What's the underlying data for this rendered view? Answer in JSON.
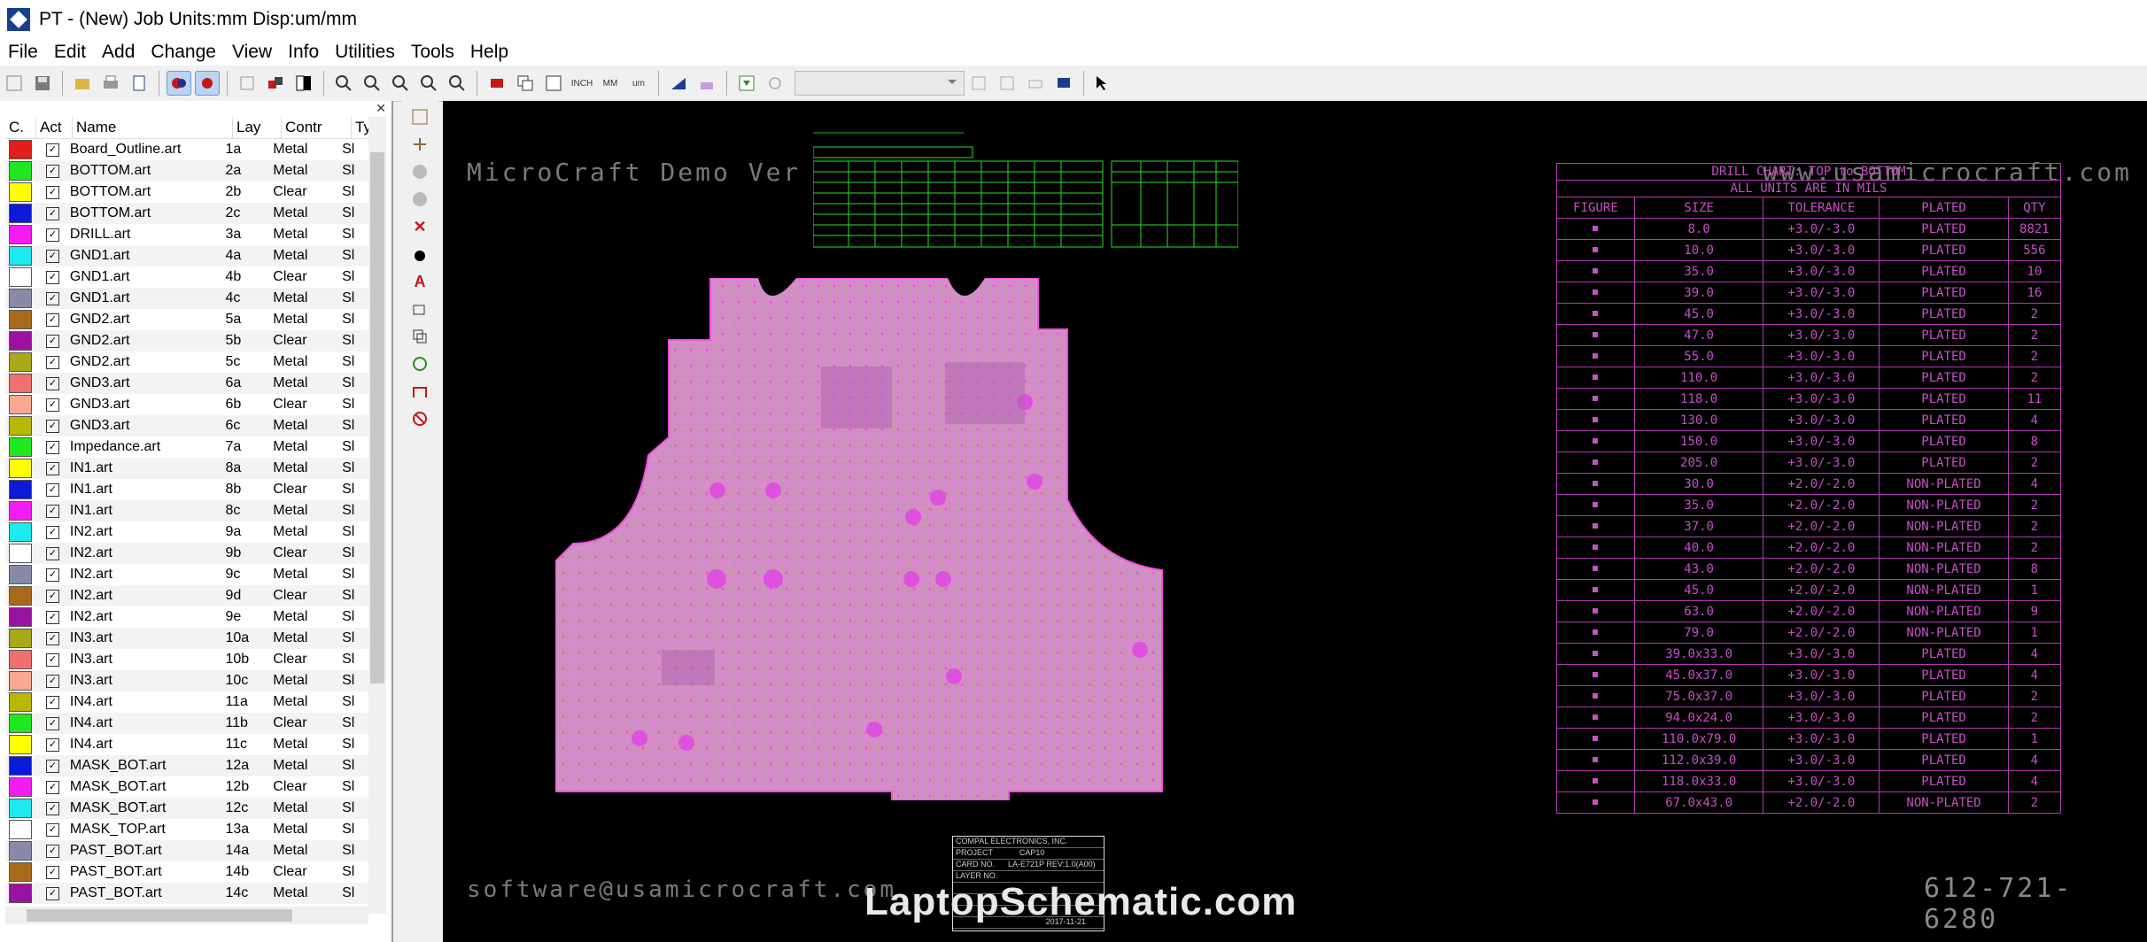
{
  "window": {
    "title": "PT - (New)  Job Units:mm Disp:um/mm"
  },
  "menu": [
    "File",
    "Edit",
    "Add",
    "Change",
    "View",
    "Info",
    "Utilities",
    "Tools",
    "Help"
  ],
  "layers": {
    "columns": [
      "C.",
      "Act",
      "Name",
      "Lay",
      "Contr",
      "Ty"
    ],
    "rows": [
      {
        "color": "#e31c1c",
        "name": "Board_Outline.art",
        "lay": "1a",
        "contr": "Metal",
        "ty": "Sl"
      },
      {
        "color": "#22e61f",
        "name": "BOTTOM.art",
        "lay": "2a",
        "contr": "Metal",
        "ty": "Sl"
      },
      {
        "color": "#ffff00",
        "name": "BOTTOM.art",
        "lay": "2b",
        "contr": "Clear",
        "ty": "Sl"
      },
      {
        "color": "#0a1ad8",
        "name": "BOTTOM.art",
        "lay": "2c",
        "contr": "Metal",
        "ty": "Sl"
      },
      {
        "color": "#f21df2",
        "name": "DRILL.art",
        "lay": "3a",
        "contr": "Metal",
        "ty": "Sl"
      },
      {
        "color": "#1ee8f0",
        "name": "GND1.art",
        "lay": "4a",
        "contr": "Metal",
        "ty": "Sl"
      },
      {
        "color": "#ffffff",
        "name": "GND1.art",
        "lay": "4b",
        "contr": "Clear",
        "ty": "Sl"
      },
      {
        "color": "#8a8aa8",
        "name": "GND1.art",
        "lay": "4c",
        "contr": "Metal",
        "ty": "Sl"
      },
      {
        "color": "#a86a1a",
        "name": "GND2.art",
        "lay": "5a",
        "contr": "Metal",
        "ty": "Sl"
      },
      {
        "color": "#9a12a0",
        "name": "GND2.art",
        "lay": "5b",
        "contr": "Clear",
        "ty": "Sl"
      },
      {
        "color": "#a8a81a",
        "name": "GND2.art",
        "lay": "5c",
        "contr": "Metal",
        "ty": "Sl"
      },
      {
        "color": "#f07070",
        "name": "GND3.art",
        "lay": "6a",
        "contr": "Metal",
        "ty": "Sl"
      },
      {
        "color": "#f8a890",
        "name": "GND3.art",
        "lay": "6b",
        "contr": "Clear",
        "ty": "Sl"
      },
      {
        "color": "#b8b800",
        "name": "GND3.art",
        "lay": "6c",
        "contr": "Metal",
        "ty": "Sl"
      },
      {
        "color": "#22e61f",
        "name": "Impedance.art",
        "lay": "7a",
        "contr": "Metal",
        "ty": "Sl"
      },
      {
        "color": "#ffff00",
        "name": "IN1.art",
        "lay": "8a",
        "contr": "Metal",
        "ty": "Sl"
      },
      {
        "color": "#0a1ad8",
        "name": "IN1.art",
        "lay": "8b",
        "contr": "Clear",
        "ty": "Sl"
      },
      {
        "color": "#f21df2",
        "name": "IN1.art",
        "lay": "8c",
        "contr": "Metal",
        "ty": "Sl"
      },
      {
        "color": "#1ee8f0",
        "name": "IN2.art",
        "lay": "9a",
        "contr": "Metal",
        "ty": "Sl"
      },
      {
        "color": "#ffffff",
        "name": "IN2.art",
        "lay": "9b",
        "contr": "Clear",
        "ty": "Sl"
      },
      {
        "color": "#8a8aa8",
        "name": "IN2.art",
        "lay": "9c",
        "contr": "Metal",
        "ty": "Sl"
      },
      {
        "color": "#a86a1a",
        "name": "IN2.art",
        "lay": "9d",
        "contr": "Clear",
        "ty": "Sl"
      },
      {
        "color": "#9a12a0",
        "name": "IN2.art",
        "lay": "9e",
        "contr": "Metal",
        "ty": "Sl"
      },
      {
        "color": "#a8a81a",
        "name": "IN3.art",
        "lay": "10a",
        "contr": "Metal",
        "ty": "Sl"
      },
      {
        "color": "#f07070",
        "name": "IN3.art",
        "lay": "10b",
        "contr": "Clear",
        "ty": "Sl"
      },
      {
        "color": "#f8a890",
        "name": "IN3.art",
        "lay": "10c",
        "contr": "Metal",
        "ty": "Sl"
      },
      {
        "color": "#b8b800",
        "name": "IN4.art",
        "lay": "11a",
        "contr": "Metal",
        "ty": "Sl"
      },
      {
        "color": "#22e61f",
        "name": "IN4.art",
        "lay": "11b",
        "contr": "Clear",
        "ty": "Sl"
      },
      {
        "color": "#ffff00",
        "name": "IN4.art",
        "lay": "11c",
        "contr": "Metal",
        "ty": "Sl"
      },
      {
        "color": "#0a1ad8",
        "name": "MASK_BOT.art",
        "lay": "12a",
        "contr": "Metal",
        "ty": "Sl"
      },
      {
        "color": "#f21df2",
        "name": "MASK_BOT.art",
        "lay": "12b",
        "contr": "Clear",
        "ty": "Sl"
      },
      {
        "color": "#1ee8f0",
        "name": "MASK_BOT.art",
        "lay": "12c",
        "contr": "Metal",
        "ty": "Sl"
      },
      {
        "color": "#ffffff",
        "name": "MASK_TOP.art",
        "lay": "13a",
        "contr": "Metal",
        "ty": "Sl"
      },
      {
        "color": "#8a8aa8",
        "name": "PAST_BOT.art",
        "lay": "14a",
        "contr": "Metal",
        "ty": "Sl"
      },
      {
        "color": "#a86a1a",
        "name": "PAST_BOT.art",
        "lay": "14b",
        "contr": "Clear",
        "ty": "Sl"
      },
      {
        "color": "#9a12a0",
        "name": "PAST_BOT.art",
        "lay": "14c",
        "contr": "Metal",
        "ty": "Sl"
      }
    ]
  },
  "canvas": {
    "watermark_top_left": "MicroCraft Demo Ver",
    "watermark_top_right": "www.usamicrocraft.com",
    "watermark_bottom_left": "software@usamicrocraft.com",
    "phone": "612-721-6280",
    "brand": "LaptopSchematic.com"
  },
  "drill_chart": {
    "title": "DRILL CHART: TOP to BOTTOM",
    "subtitle": "ALL UNITS ARE IN MILS",
    "headers": [
      "FIGURE",
      "SIZE",
      "TOLERANCE",
      "PLATED",
      "QTY"
    ],
    "rows": [
      [
        "8.0",
        "+3.0/-3.0",
        "PLATED",
        "8821"
      ],
      [
        "10.0",
        "+3.0/-3.0",
        "PLATED",
        "556"
      ],
      [
        "35.0",
        "+3.0/-3.0",
        "PLATED",
        "10"
      ],
      [
        "39.0",
        "+3.0/-3.0",
        "PLATED",
        "16"
      ],
      [
        "45.0",
        "+3.0/-3.0",
        "PLATED",
        "2"
      ],
      [
        "47.0",
        "+3.0/-3.0",
        "PLATED",
        "2"
      ],
      [
        "55.0",
        "+3.0/-3.0",
        "PLATED",
        "2"
      ],
      [
        "110.0",
        "+3.0/-3.0",
        "PLATED",
        "2"
      ],
      [
        "118.0",
        "+3.0/-3.0",
        "PLATED",
        "11"
      ],
      [
        "130.0",
        "+3.0/-3.0",
        "PLATED",
        "4"
      ],
      [
        "150.0",
        "+3.0/-3.0",
        "PLATED",
        "8"
      ],
      [
        "205.0",
        "+3.0/-3.0",
        "PLATED",
        "2"
      ],
      [
        "30.0",
        "+2.0/-2.0",
        "NON-PLATED",
        "4"
      ],
      [
        "35.0",
        "+2.0/-2.0",
        "NON-PLATED",
        "2"
      ],
      [
        "37.0",
        "+2.0/-2.0",
        "NON-PLATED",
        "2"
      ],
      [
        "40.0",
        "+2.0/-2.0",
        "NON-PLATED",
        "2"
      ],
      [
        "43.0",
        "+2.0/-2.0",
        "NON-PLATED",
        "8"
      ],
      [
        "45.0",
        "+2.0/-2.0",
        "NON-PLATED",
        "1"
      ],
      [
        "63.0",
        "+2.0/-2.0",
        "NON-PLATED",
        "9"
      ],
      [
        "79.0",
        "+2.0/-2.0",
        "NON-PLATED",
        "1"
      ],
      [
        "39.0x33.0",
        "+3.0/-3.0",
        "PLATED",
        "4"
      ],
      [
        "45.0x37.0",
        "+3.0/-3.0",
        "PLATED",
        "4"
      ],
      [
        "75.0x37.0",
        "+3.0/-3.0",
        "PLATED",
        "2"
      ],
      [
        "94.0x24.0",
        "+3.0/-3.0",
        "PLATED",
        "2"
      ],
      [
        "110.0x79.0",
        "+3.0/-3.0",
        "PLATED",
        "1"
      ],
      [
        "112.0x39.0",
        "+3.0/-3.0",
        "PLATED",
        "4"
      ],
      [
        "118.0x33.0",
        "+3.0/-3.0",
        "PLATED",
        "4"
      ],
      [
        "67.0x43.0",
        "+2.0/-2.0",
        "NON-PLATED",
        "2"
      ]
    ]
  },
  "title_block": {
    "company": "COMPAL ELECTRONICS, INC.",
    "project_label": "PROJECT",
    "project": "CAP10",
    "card_label": "CARD NO.",
    "card": "LA-E721P REV:1.0(A00)",
    "layer_label": "LAYER NO.",
    "date": "2017-11-21"
  },
  "colors": {
    "pcb_pink": "#e878d8",
    "chart_magenta": "#c650c6",
    "stack_green": "#22e61f"
  }
}
